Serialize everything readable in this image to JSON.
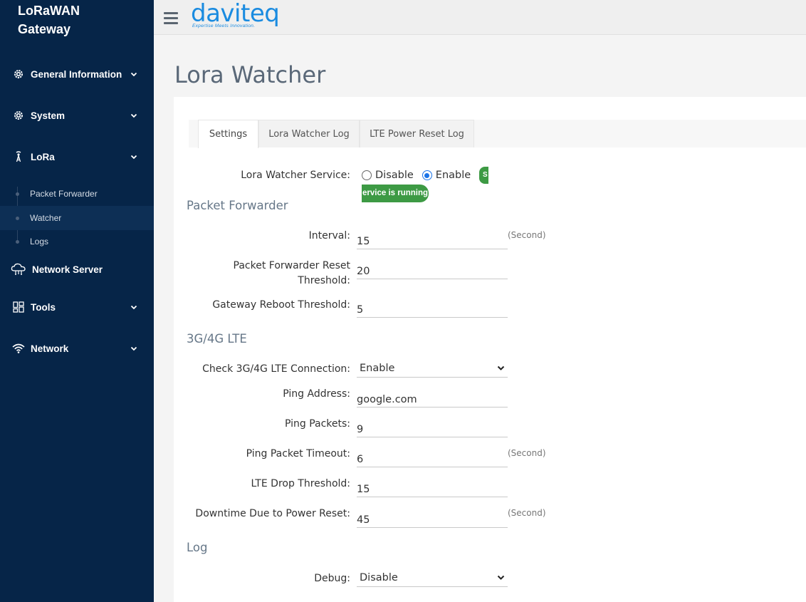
{
  "sidebar": {
    "brand_line1": "LoRaWAN",
    "brand_line2": "Gateway",
    "items": [
      {
        "label": "General Information",
        "icon": "gear-icon"
      },
      {
        "label": "System",
        "icon": "gear-icon"
      },
      {
        "label": "LoRa",
        "icon": "antenna-icon"
      },
      {
        "label": "Network Server",
        "icon": "cloud-icon"
      },
      {
        "label": "Tools",
        "icon": "grid-icon"
      },
      {
        "label": "Network",
        "icon": "wifi-icon"
      }
    ],
    "lora_sub": [
      {
        "label": "Packet Forwarder"
      },
      {
        "label": "Watcher"
      },
      {
        "label": "Logs"
      }
    ]
  },
  "topbar": {
    "logo_word": "daviteq",
    "logo_tagline": "Expertise Meets Innovation."
  },
  "page": {
    "title": "Lora Watcher"
  },
  "tabs": [
    {
      "label": "Settings"
    },
    {
      "label": "Lora Watcher Log"
    },
    {
      "label": "LTE Power Reset Log"
    }
  ],
  "service": {
    "label": "Lora Watcher Service:",
    "disable_label": "Disable",
    "enable_label": "Enable",
    "badge_fragment": "S",
    "status_text": "ervice is running"
  },
  "packet_forwarder": {
    "section_title": "Packet Forwarder",
    "interval_label": "Interval:",
    "interval_value": "15",
    "interval_unit": "(Second)",
    "reset_threshold_label": "Packet Forwarder Reset Threshold:",
    "reset_threshold_value": "20",
    "reboot_threshold_label": "Gateway Reboot Threshold:",
    "reboot_threshold_value": "5"
  },
  "lte": {
    "section_title": "3G/4G LTE",
    "check_label": "Check 3G/4G LTE Connection:",
    "check_value": "Enable",
    "ping_address_label": "Ping Address:",
    "ping_address_value": "google.com",
    "ping_packets_label": "Ping Packets:",
    "ping_packets_value": "9",
    "ping_timeout_label": "Ping Packet Timeout:",
    "ping_timeout_value": "6",
    "ping_timeout_unit": "(Second)",
    "drop_threshold_label": "LTE Drop Threshold:",
    "drop_threshold_value": "15",
    "downtime_label": "Downtime Due to Power Reset:",
    "downtime_value": "45",
    "downtime_unit": "(Second)"
  },
  "log": {
    "section_title": "Log",
    "debug_label": "Debug:",
    "debug_value": "Disable"
  },
  "colors": {
    "sidebar_bg": "#062548",
    "accent": "#1a8be0",
    "success": "#3d9a44"
  }
}
